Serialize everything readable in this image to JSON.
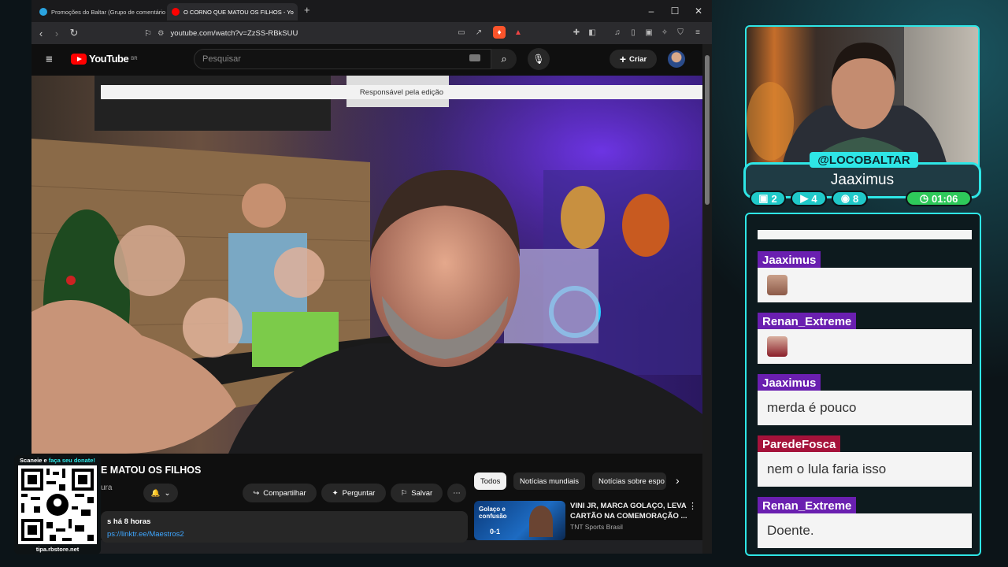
{
  "browser": {
    "tabs": [
      {
        "label": "Promoções do Baltar (Grupo de comentários"
      },
      {
        "label": "O CORNO QUE MATOU OS FILHOS - Yo"
      }
    ],
    "new_tab": "+",
    "url": "youtube.com/watch?v=ZzSS-RBkSUU"
  },
  "youtube": {
    "logo": "YouTube",
    "region": "BR",
    "search_placeholder": "Pesquisar",
    "create_label": "Criar",
    "video_title": "E MATOU OS FILHOS",
    "channel_partial": "ura",
    "actions": {
      "share": "Compartilhar",
      "ask": "Perguntar",
      "save": "Salvar"
    },
    "description": {
      "meta": "s há 8 horas",
      "link": "ps://linktr.ee/Maestros2"
    },
    "chips": [
      "Todos",
      "Notícias mundiais",
      "Notícias sobre espo"
    ],
    "recommended": {
      "thumb_text": "Golaço e confusão",
      "thumb_score": "0-1",
      "title": "VINI JR, MARCA GOLAÇO, LEVA CARTÃO NA COMEMORAÇÃO ...",
      "channel": "TNT Sports Brasil"
    },
    "status_bar": "Responsável pela edição"
  },
  "qr": {
    "top_text_plain": "Scaneie e ",
    "top_text_highlight": "faça seu donate!",
    "bottom_text": "tipa.rbstore.net"
  },
  "stream": {
    "handle": "@LOCOBALTAR",
    "viewer_name": "Jaaximus",
    "stats": [
      {
        "icon": "twitch-icon",
        "value": "2"
      },
      {
        "icon": "youtube-icon",
        "value": "4"
      },
      {
        "icon": "kick-icon",
        "value": "8"
      },
      {
        "icon": "clock-icon",
        "value": "01:06"
      }
    ]
  },
  "chat": [
    {
      "user": "Jaaximus",
      "text": "",
      "emote": true,
      "color": "#6a1fb0"
    },
    {
      "user": "Renan_Extreme",
      "text": "",
      "emote": true,
      "color": "#6a1fb0"
    },
    {
      "user": "Jaaximus",
      "text": "merda é pouco",
      "color": "#6a1fb0"
    },
    {
      "user": "ParedeFosca",
      "text": "nem o lula faria isso",
      "color": "#a5123a"
    },
    {
      "user": "Renan_Extreme",
      "text": "Doente.",
      "color": "#6a1fb0"
    }
  ],
  "colors": {
    "accent": "#2ee6e6",
    "yt_red": "#ff0000"
  }
}
